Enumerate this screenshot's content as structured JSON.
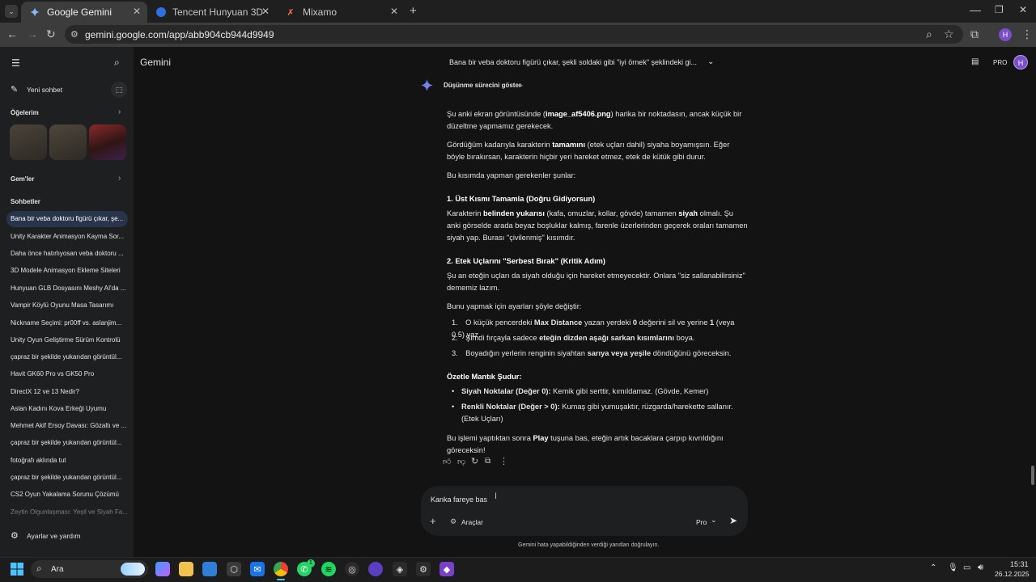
{
  "browser": {
    "tabs": [
      {
        "label": "Google Gemini",
        "active": true
      },
      {
        "label": "Tencent Hunyuan 3D",
        "active": false
      },
      {
        "label": "Mixamo",
        "active": false
      }
    ],
    "url": "gemini.google.com/app/abb904cb944d9949"
  },
  "sidebar": {
    "new_chat": "Yeni sohbet",
    "items_header": "Öğelerim",
    "gems_header": "Gem'ler",
    "chats_header": "Sohbetler",
    "chats": [
      "Bana bir veba doktoru figürü çıkar, şe...",
      "Unity Karakter Animasyon Kayma Sor...",
      "Daha önce hatırlıyosan veba doktoru ...",
      "3D Modele Animasyon Ekleme Siteleri",
      "Hunyuan GLB Dosyasını Meshy AI'da ...",
      "Vampir Köylü Oyunu Masa Tasarımı",
      "Nickname Seçimi: pr00ff vs. aslanjim...",
      "Unity Oyun Geliştirme Sürüm Kontrolü",
      "çapraz bir şekilde yukarıdan görüntül...",
      "Havit GK60 Pro vs GK50 Pro",
      "DirectX 12 ve 13 Nedir?",
      "Aslan Kadını Kova Erkeği Uyumu",
      "Mehmet Akif Ersoy Davası: Gözaltı ve ...",
      "çapraz bir şekilde yukarıdan görüntül...",
      "fotoğrafı aklında tut",
      "çapraz bir şekilde yukarıdan görüntül...",
      "CS2 Oyun Yakalama Sorunu Çözümü",
      "Zeytin Olgunlaşması: Yeşil ve Siyah Fa..."
    ],
    "settings": "Ayarlar ve yardım"
  },
  "header": {
    "app_name": "Gemini",
    "conversation_title": "Bana bir veba doktoru figürü çıkar, şekli soldaki gibi \"iyi örnek\" şeklindeki gi...",
    "pro_badge": "PRO",
    "avatar_letter": "H"
  },
  "response": {
    "thinking_toggle": "Düşünme sürecini göster",
    "p1_a": "Şu anki ekran görüntüsünde (",
    "p1_b": "image_af5406.png",
    "p1_c": ") harika bir noktadasın, ancak küçük bir düzeltme yapmamız gerekecek.",
    "p2_a": "Gördüğüm kadarıyla karakterin ",
    "p2_b": "tamamını",
    "p2_c": " (etek uçları dahil) siyaha boyamışsın. Eğer böyle bırakırsan, karakterin hiçbir yeri hareket etmez, etek de kütük gibi durur.",
    "p3": "Bu kısımda yapman gerekenler şunlar:",
    "h1": "1. Üst Kısmı Tamamla (Doğru Gidiyorsun)",
    "p4_a": "Karakterin ",
    "p4_b": "belinden yukarısı",
    "p4_c": " (kafa, omuzlar, kollar, gövde) tamamen ",
    "p4_d": "siyah",
    "p4_e": " olmalı. Şu anki görselde arada beyaz boşluklar kalmış, farenle üzerlerinden geçerek oraları tamamen siyah yap. Burası \"çivilenmiş\" kısımdır.",
    "h2": "2. Etek Uçlarını \"Serbest Bırak\" (Kritik Adım)",
    "p5": "Şu an eteğin uçları da siyah olduğu için hareket etmeyecektir. Onlara \"siz sallanabilirsiniz\" dememiz lazım.",
    "p6": "Bunu yapmak için ayarları şöyle değiştir:",
    "s1_a": "O küçük pencerdeki ",
    "s1_b": "Max Distance",
    "s1_c": " yazan yerdeki ",
    "s1_d": "0",
    "s1_e": " değerini sil ve yerine ",
    "s1_f": "1",
    "s1_g": " (veya 0.5) yaz.",
    "s2_a": "Şimdi fırçayla sadece ",
    "s2_b": "eteğin dizden aşağı sarkan kısımlarını",
    "s2_c": " boya.",
    "s3_a": "Boyadığın yerlerin renginin siyahtan ",
    "s3_b": "sarıya veya yeşile",
    "s3_c": " döndüğünü göreceksin.",
    "h3": "Özetle Mantık Şudur:",
    "b1_a": "Siyah Noktalar (Değer 0):",
    "b1_b": " Kemik gibi serttir, kımıldamaz. (Gövde, Kemer)",
    "b2_a": "Renkli Noktalar (Değer > 0):",
    "b2_b": " Kumaş gibi yumuşaktır, rüzgarda/harekette sallanır. (Etek Uçları)",
    "p7_a": "Bu işlemi yaptıktan sonra ",
    "p7_b": "Play",
    "p7_c": " tuşuna bas, eteğin artık bacaklara çarpıp kıvrıldığını göreceksin!"
  },
  "composer": {
    "typed_text": "Kanka fareye bas",
    "tools_label": "Araçlar",
    "model_label": "Pro",
    "disclaimer": "Gemini hata yapabildiğinden verdiği yanıtları doğrulayın."
  },
  "taskbar": {
    "search_label": "Ara",
    "time": "15:31",
    "date": "26.12.2025",
    "whatsapp_badge": "1"
  }
}
